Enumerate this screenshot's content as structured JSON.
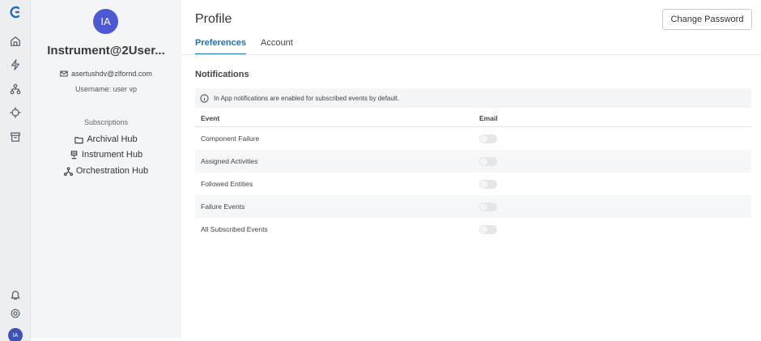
{
  "rail": {
    "avatar_initials": "IA",
    "icons": [
      "logo-icon",
      "home-icon",
      "lightning-icon",
      "hierarchy-icon",
      "component-icon",
      "archive-icon",
      "bell-icon",
      "settings-icon"
    ]
  },
  "profile": {
    "initials": "IA",
    "name": "Instrument@2User...",
    "email": "asertushdv@zlfornd.com",
    "username": "Username:  user vp",
    "subscriptions_title": "Subscriptions",
    "subscriptions": [
      {
        "label": "Archival Hub",
        "icon": "folder-icon"
      },
      {
        "label": "Instrument Hub",
        "icon": "instrument-icon"
      },
      {
        "label": "Orchestration Hub",
        "icon": "orchestration-icon"
      }
    ]
  },
  "main": {
    "title": "Profile",
    "change_password_label": "Change Password",
    "tabs": [
      {
        "label": "Preferences",
        "active": true
      },
      {
        "label": "Account",
        "active": false
      }
    ],
    "section_title": "Notifications",
    "info_text": "In App notifications are enabled for subscribed events by default.",
    "table": {
      "headers": [
        "Event",
        "Email"
      ],
      "rows": [
        {
          "event": "Component Failure",
          "email_enabled": false
        },
        {
          "event": "Assigned Activities",
          "email_enabled": false
        },
        {
          "event": "Followed Entities",
          "email_enabled": false
        },
        {
          "event": "Failure Events",
          "email_enabled": false
        },
        {
          "event": "All Subscribed Events",
          "email_enabled": false
        }
      ]
    }
  },
  "colors": {
    "accent": "#1f6fb8",
    "avatar": "#4c58d4",
    "rail_bg": "#eceef0",
    "panel_bg": "#f3f5f7"
  }
}
